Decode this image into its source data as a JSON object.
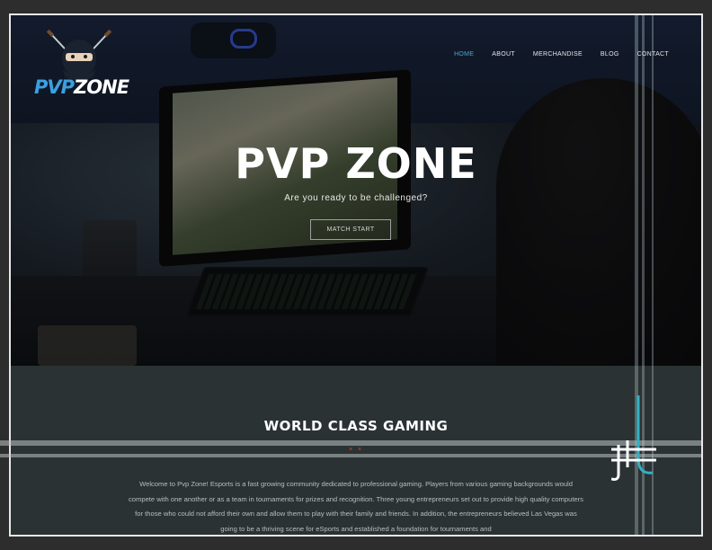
{
  "brand": {
    "logo_pvp": "PVP",
    "logo_zone": "ZONE"
  },
  "nav": {
    "items": [
      {
        "label": "HOME",
        "active": true
      },
      {
        "label": "ABOUT",
        "active": false
      },
      {
        "label": "MERCHANDISE",
        "active": false
      },
      {
        "label": "BLOG",
        "active": false
      },
      {
        "label": "CONTACT",
        "active": false
      }
    ]
  },
  "hero": {
    "title": "PVP ZONE",
    "subtitle": "Are you ready to be challenged?",
    "cta_label": "MATCH START"
  },
  "section": {
    "title": "WORLD CLASS GAMING",
    "divider": "× ×",
    "body": "Welcome to Pvp Zone! Esports is a fast growing community dedicated to professional gaming. Players from various gaming backgrounds would compete with one another or as a team in tournaments for prizes and recognition. Three young entrepreneurs set out to provide high quality computers for those who could not afford their own and allow them to play with their family and friends. In addition, the entrepreneurs believed Las Vegas was going to be a thriving scene for eSports and established a foundation for tournaments and"
  },
  "colors": {
    "accent": "#47a6d6",
    "divider_red": "#d4463c",
    "section_bg": "#2b3233",
    "monogram": "#2fb3c8"
  }
}
